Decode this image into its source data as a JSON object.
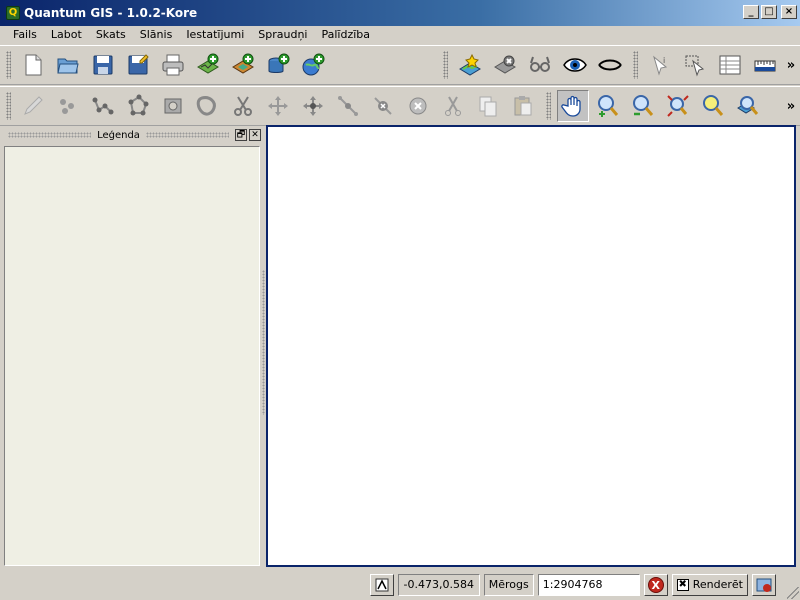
{
  "window": {
    "title": "Quantum GIS - 1.0.2-Kore",
    "minimize_icon": "minimize-icon",
    "maximize_icon": "maximize-icon",
    "close_icon": "close-icon"
  },
  "menu": {
    "items": [
      "Fails",
      "Labot",
      "Skats",
      "Slānis",
      "Iestatījumi",
      "Spraudņi",
      "Palīdzība"
    ]
  },
  "toolbar1": {
    "file_icons": [
      "new-project-icon",
      "open-project-icon",
      "save-project-icon",
      "save-as-icon",
      "print-icon"
    ],
    "layer_icons": [
      "add-vector-layer-icon",
      "add-raster-layer-icon",
      "add-postgis-layer-icon",
      "add-wms-layer-icon"
    ],
    "legend_icons": [
      "new-vector-layer-icon",
      "remove-layer-icon",
      "show-all-layers-icon",
      "show-layers-icon",
      "hide-layers-icon"
    ],
    "attr_icons": [
      "identify-icon",
      "select-features-icon",
      "attribute-table-icon",
      "measure-icon"
    ],
    "overflow_label": "»"
  },
  "toolbar2": {
    "digitize_icons": [
      "toggle-editing-icon",
      "capture-point-icon",
      "capture-line-icon",
      "capture-polygon-icon",
      "add-ring-icon",
      "add-island-icon",
      "split-features-icon",
      "move-feature-icon",
      "move-vertex-icon",
      "add-vertex-icon",
      "delete-vertex-icon",
      "delete-selected-icon",
      "cut-features-icon",
      "copy-features-icon",
      "paste-features-icon"
    ],
    "nav_icons": [
      "pan-icon",
      "zoom-in-icon",
      "zoom-out-icon",
      "zoom-full-icon",
      "zoom-selection-icon",
      "zoom-layer-icon"
    ],
    "overflow_label": "»"
  },
  "legend": {
    "title": "Leģenda",
    "float_label": "🗗",
    "close_label": "✕"
  },
  "statusbar": {
    "coordinates": "-0.473,0.584",
    "scale_label": "Mērogs",
    "scale_value": "1:2904768",
    "stop_label": "X",
    "render_label": "Renderēt",
    "render_checked_glyph": "✖"
  },
  "colors": {
    "titlebar_start": "#0a246a",
    "titlebar_end": "#a6caf0",
    "canvas_border": "#0a246a",
    "legend_bg": "#efefe4",
    "chrome": "#d4d0c8"
  }
}
